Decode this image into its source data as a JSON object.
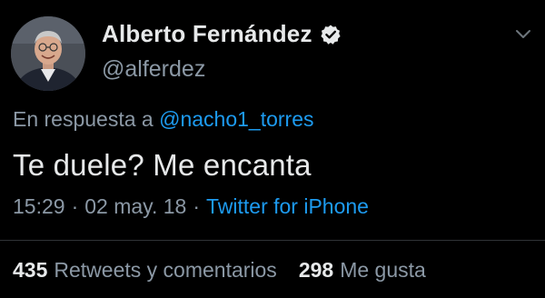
{
  "tweet": {
    "author": {
      "display_name": "Alberto Fernández",
      "handle": "@alferdez",
      "verified": true,
      "avatar_icon": "profile-photo"
    },
    "reply": {
      "prefix": "En respuesta a",
      "mention": "@nacho1_torres"
    },
    "text": "Te duele? Me encanta",
    "meta": {
      "time": "15:29",
      "dot1": "·",
      "date": "02 may. 18",
      "dot2": "·",
      "source": "Twitter for iPhone"
    },
    "stats": {
      "retweets_count": "435",
      "retweets_label": "Retweets y comentarios",
      "likes_count": "298",
      "likes_label": "Me gusta"
    },
    "menu_icon": "chevron-down-icon"
  },
  "colors": {
    "background": "#000000",
    "primary_text": "#e7e9ea",
    "secondary_text": "#8b98a5",
    "accent": "#1d9bf0",
    "divider": "#2f3336"
  }
}
